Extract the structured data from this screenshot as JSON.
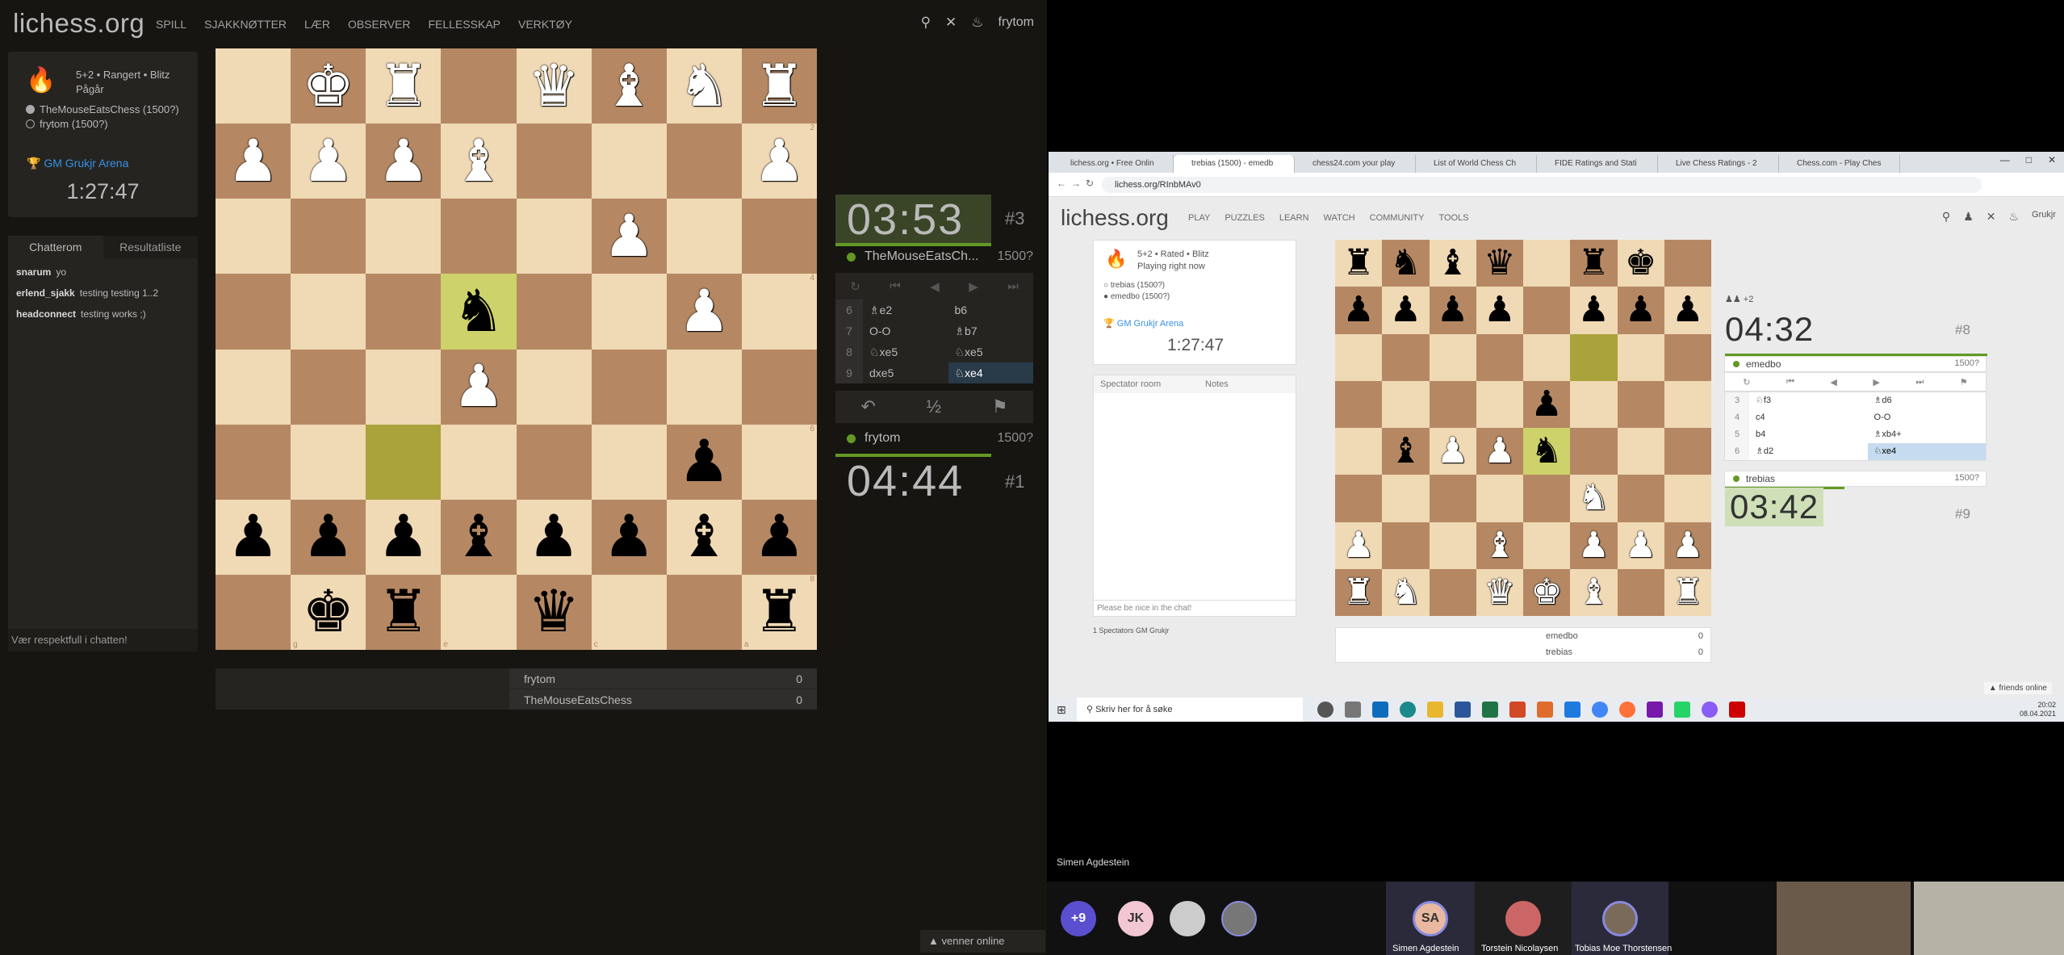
{
  "left": {
    "logo": "lichess.org",
    "nav": [
      "SPILL",
      "SJAKKNØTTER",
      "LÆR",
      "OBSERVER",
      "FELLESSKAP",
      "VERKTØY"
    ],
    "user": "frytom",
    "game": {
      "setup": "5+2 • Rangert • Blitz",
      "status": "Pågår",
      "white_player": "TheMouseEatsChess (1500?)",
      "black_player": "frytom (1500?)"
    },
    "arena": {
      "name": "GM Grukjr Arena",
      "clock": "1:27:47"
    },
    "chat": {
      "tabs": [
        "Chatterom",
        "Resultatliste"
      ],
      "lines": [
        {
          "user": "snarum",
          "text": "yo"
        },
        {
          "user": "erlend_sjakk",
          "text": "testing testing 1..2"
        },
        {
          "user": "headconnect",
          "text": "testing works ;)"
        }
      ],
      "placeholder": "Vær respektfull i chatten!"
    },
    "files_bottom": [
      "h",
      "g",
      "f",
      "e",
      "d",
      "c",
      "b",
      "a"
    ],
    "ranks_right": [
      "1",
      "2",
      "3",
      "4",
      "5",
      "6",
      "7",
      "8"
    ],
    "board": [
      [
        "",
        "K",
        "R",
        "",
        "Q",
        "B",
        "N",
        "R"
      ],
      [
        "P",
        "P",
        "P",
        "B",
        "",
        "",
        "",
        "P"
      ],
      [
        "",
        "",
        "",
        "",
        "",
        "P",
        "",
        ""
      ],
      [
        "",
        "",
        "",
        "n",
        "",
        "",
        "P",
        ""
      ],
      [
        "",
        "",
        "",
        "P",
        "",
        "",
        "",
        ""
      ],
      [
        "",
        "",
        "",
        "",
        "",
        "",
        "p",
        ""
      ],
      [
        "p",
        "p",
        "p",
        "b",
        "p",
        "p",
        "b",
        "p"
      ],
      [
        "",
        "k",
        "r",
        "",
        "q",
        "",
        "",
        "r"
      ]
    ],
    "score": [
      {
        "name": "frytom",
        "points": "0"
      },
      {
        "name": "TheMouseEatsChess",
        "points": "0"
      }
    ],
    "top_clock": {
      "min": "03",
      "sec": "53",
      "rank": "#3",
      "player": "TheMouseEatsCh...",
      "rating": "1500?"
    },
    "bottom_clock": {
      "min": "04",
      "sec": "44",
      "rank": "#1",
      "player": "frytom",
      "rating": "1500?"
    },
    "moves": [
      {
        "n": "6",
        "w": "♗e2",
        "b": "b6"
      },
      {
        "n": "7",
        "w": "O-O",
        "b": "♗b7"
      },
      {
        "n": "8",
        "w": "♘xe5",
        "b": "♘xe5"
      },
      {
        "n": "9",
        "w": "dxe5",
        "b": "♘xe4"
      }
    ],
    "draw_label": "½",
    "online": "venner online"
  },
  "right": {
    "tabs": [
      "lichess.org • Free Onlin",
      "trebias (1500) - emedb",
      "chess24.com your play",
      "List of World Chess Ch",
      "FIDE Ratings and Stati",
      "Live Chess Ratings - 2",
      "Chess.com - Play Ches"
    ],
    "url": "lichess.org/RInbMAv0",
    "logo": "lichess.org",
    "nav": [
      "PLAY",
      "PUZZLES",
      "LEARN",
      "WATCH",
      "COMMUNITY",
      "TOOLS"
    ],
    "user": "Grukjr",
    "game": {
      "setup": "5+2 • Rated • Blitz",
      "status": "Playing right now",
      "white_player": "trebias (1500?)",
      "black_player": "emedbo (1500?)"
    },
    "arena": {
      "name": "GM Grukjr Arena",
      "clock": "1:27:47"
    },
    "chat_tabs": [
      "Spectator room",
      "Notes"
    ],
    "chat_placeholder": "Please be nice in the chat!",
    "spectators": "1 Spectators GM Grukjr",
    "board": [
      [
        "r",
        "n",
        "b",
        "q",
        "",
        "r",
        "k",
        ""
      ],
      [
        "p",
        "p",
        "p",
        "p",
        "",
        "p",
        "p",
        "p"
      ],
      [
        "",
        "",
        "",
        "",
        "",
        "",
        "",
        ""
      ],
      [
        "",
        "",
        "",
        "",
        "p",
        "",
        "",
        ""
      ],
      [
        "",
        "b",
        "P",
        "P",
        "n",
        "",
        "",
        ""
      ],
      [
        "",
        "",
        "",
        "",
        "",
        "N",
        "",
        ""
      ],
      [
        "P",
        "",
        "",
        "B",
        "",
        "P",
        "P",
        "P"
      ],
      [
        "R",
        "N",
        "",
        "Q",
        "K",
        "B",
        "",
        "R"
      ]
    ],
    "score": [
      {
        "name": "emedbo",
        "points": "0"
      },
      {
        "name": "trebias",
        "points": "0"
      }
    ],
    "top_clock": {
      "min": "04",
      "sec": "32",
      "rank": "#8",
      "player": "emedbo",
      "rating": "1500?"
    },
    "bottom_clock": {
      "min": "03",
      "sec": "42",
      "rank": "#9",
      "player": "trebias",
      "rating": "1500?"
    },
    "pieces_lost": "+2",
    "moves": [
      {
        "n": "3",
        "w": "♘f3",
        "b": "♗d6"
      },
      {
        "n": "4",
        "w": "c4",
        "b": "O-O"
      },
      {
        "n": "5",
        "w": "b4",
        "b": "♗xb4+"
      },
      {
        "n": "6",
        "w": "♗d2",
        "b": "♘xe4"
      }
    ],
    "friends": "friends online",
    "taskbar_search": "Skriv her for å søke",
    "clock_time": "20:02",
    "clock_date": "08.04.2021"
  },
  "video": {
    "speaker": "Simen Agdestein",
    "more": "+9",
    "initials": [
      "JK",
      "SA"
    ],
    "names": [
      "Simen Agdestein",
      "Torstein Nicolaysen",
      "Tobias Moe Thorstensen"
    ]
  }
}
